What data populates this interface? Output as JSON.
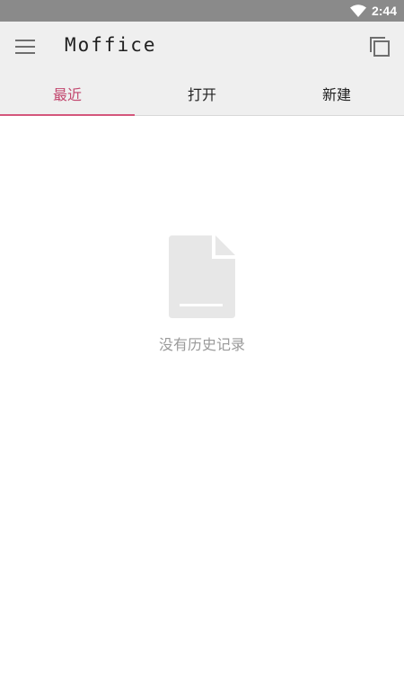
{
  "status_bar": {
    "time": "2:44",
    "icons": [
      "wifi-icon"
    ]
  },
  "app_bar": {
    "title": "Moffice",
    "left_icon": "menu-icon",
    "right_icon": "copy-icon"
  },
  "tabs": [
    {
      "label": "最近",
      "active": true
    },
    {
      "label": "打开",
      "active": false
    },
    {
      "label": "新建",
      "active": false
    }
  ],
  "empty_state": {
    "icon": "document-icon",
    "message": "没有历史记录"
  },
  "colors": {
    "status_bar": "#8a8a8a",
    "app_bar": "#efefef",
    "accent": "#d4567b",
    "empty_icon": "#e7e7e7",
    "empty_text": "#9a9a9a"
  }
}
